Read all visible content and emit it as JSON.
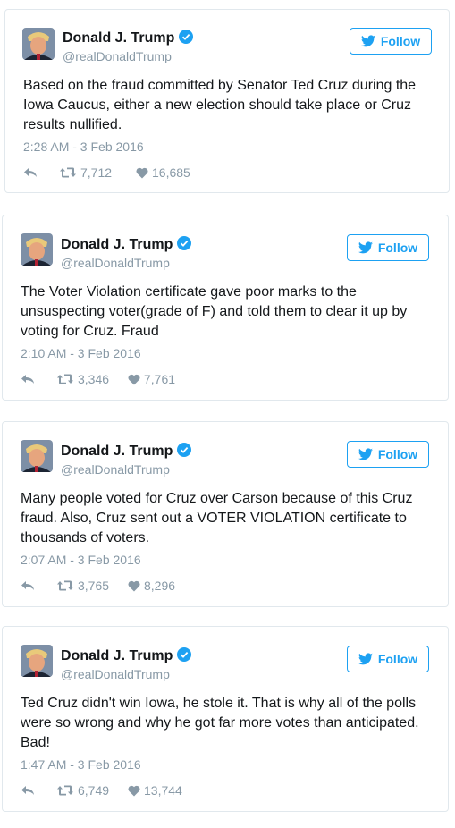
{
  "colors": {
    "accent": "#1da1f2",
    "muted": "#8899a6",
    "border": "#e1e8ed",
    "text": "#14171a"
  },
  "tweets": [
    {
      "name": "Donald J. Trump",
      "handle": "@realDonaldTrump",
      "follow_label": "Follow",
      "text_lines": [
        "Based on the fraud committed by Senator Ted Cruz during the",
        "Iowa Caucus, either a new election should take place or Cruz",
        "results nullified."
      ],
      "timestamp": "2:28 AM - 3 Feb 2016",
      "retweets": "7,712",
      "likes": "16,685"
    },
    {
      "name": "Donald J. Trump",
      "handle": "@realDonaldTrump",
      "follow_label": "Follow",
      "text_lines": [
        "The Voter Violation certificate gave poor marks to the",
        "unsuspecting voter(grade of F) and told them to clear it up by",
        "voting for Cruz. Fraud"
      ],
      "timestamp": "2:10 AM - 3 Feb 2016",
      "retweets": "3,346",
      "likes": "7,761"
    },
    {
      "name": "Donald J. Trump",
      "handle": "@realDonaldTrump",
      "follow_label": "Follow",
      "text_lines": [
        "Many people voted for Cruz over Carson because of this Cruz",
        "fraud. Also, Cruz sent out a VOTER VIOLATION certificate to",
        "thousands of voters."
      ],
      "timestamp": "2:07 AM - 3 Feb 2016",
      "retweets": "3,765",
      "likes": "8,296"
    },
    {
      "name": "Donald J. Trump",
      "handle": "@realDonaldTrump",
      "follow_label": "Follow",
      "text_lines": [
        "Ted Cruz didn't win Iowa, he stole it. That is why all of the polls",
        "were so wrong and why he got far more votes than anticipated.",
        "Bad!"
      ],
      "timestamp": "1:47 AM - 3 Feb 2016",
      "retweets": "6,749",
      "likes": "13,744"
    }
  ]
}
